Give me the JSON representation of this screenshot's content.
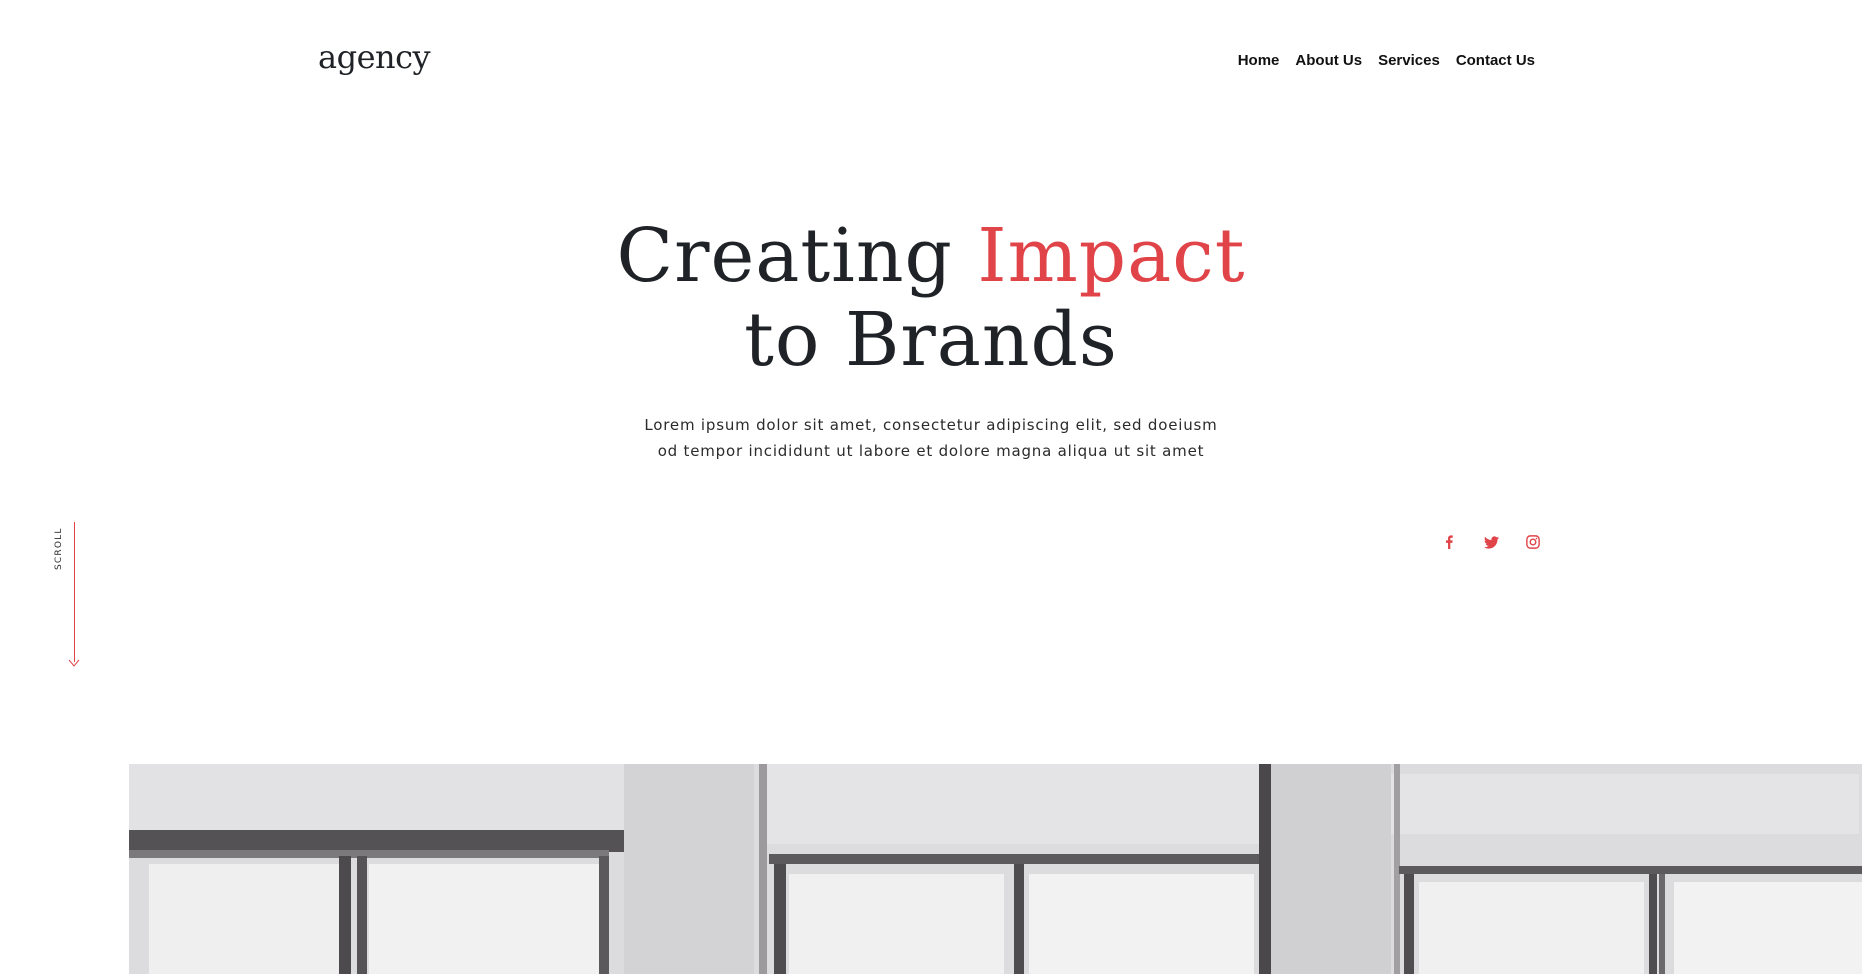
{
  "header": {
    "logo": "agency",
    "nav": [
      "Home",
      "About Us",
      "Services",
      "Contact Us"
    ]
  },
  "hero": {
    "title_part1": "Creating ",
    "title_accent": "Impact",
    "title_line2": "to Brands",
    "subtitle_line1": "Lorem ipsum dolor sit amet, consectetur adipiscing elit, sed doeiusm",
    "subtitle_line2": "od tempor incididunt ut labore et dolore magna aliqua ut sit amet"
  },
  "social": {
    "icons": [
      "facebook-icon",
      "twitter-icon",
      "instagram-icon"
    ]
  },
  "scroll": {
    "label": "SCROLL"
  },
  "colors": {
    "accent": "#e04449",
    "text": "#1f2226",
    "image_bg": "#d9d8da"
  }
}
